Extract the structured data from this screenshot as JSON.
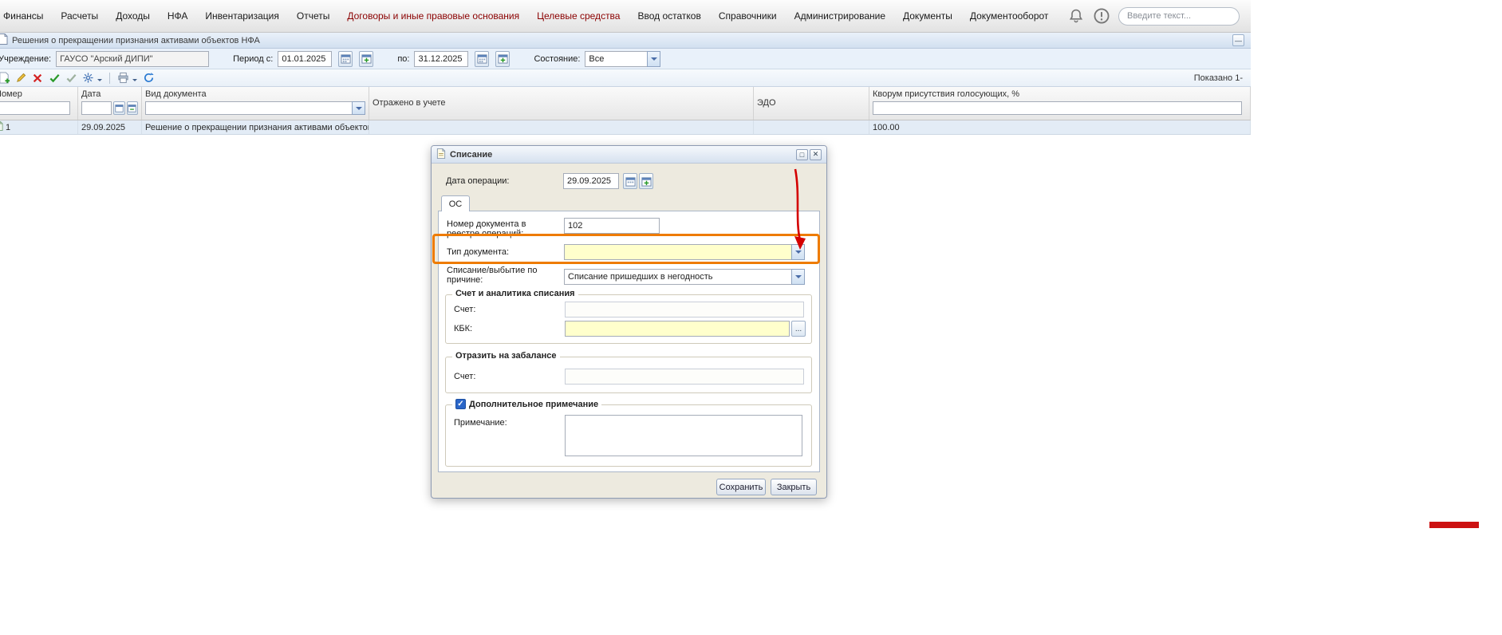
{
  "colors": {
    "menu_accent": "#8b0000",
    "annotation_orange": "#ee7b00",
    "annotation_red": "#d40000",
    "required_field_bg": "#ffffcc"
  },
  "menubar": {
    "items": [
      {
        "label": "Финансы"
      },
      {
        "label": "Расчеты"
      },
      {
        "label": "Доходы"
      },
      {
        "label": "НФА"
      },
      {
        "label": "Инвентаризация"
      },
      {
        "label": "Отчеты"
      },
      {
        "label": "Договоры и иные правовые основания"
      },
      {
        "label": "Целевые средства"
      },
      {
        "label": "Ввод остатков"
      },
      {
        "label": "Справочники"
      },
      {
        "label": "Администрирование"
      },
      {
        "label": "Документы"
      },
      {
        "label": "Документооборот"
      }
    ],
    "search_placeholder": "Введите текст..."
  },
  "panel": {
    "title": "Решения о прекращении признания активами объектов НФА",
    "collapse_glyph": "—",
    "filters": {
      "institution_label": "Учреждение:",
      "institution_value": "ГАУСО \"Арский ДИПИ\"",
      "period_from_label": "Период с:",
      "period_from_value": "01.01.2025",
      "period_to_label": "по:",
      "period_to_value": "31.12.2025",
      "state_label": "Состояние:",
      "state_value": "Все"
    },
    "toolbar": {
      "icons": [
        "add-icon",
        "edit-icon",
        "delete-icon",
        "approve-icon",
        "confirm-icon",
        "actions-icon",
        "print-icon",
        "refresh-icon"
      ],
      "shown_text": "Показано 1-"
    },
    "grid": {
      "columns": [
        "Номер",
        "Дата",
        "Вид документа",
        "Отражено в учете",
        "ЭДО",
        "Кворум присутствия голосующих, %"
      ],
      "rows": [
        {
          "number": "1",
          "date": "29.09.2025",
          "doc_kind": "Решение о прекращении признания активами объектов НФА",
          "reflected": "",
          "edo": "",
          "quorum": "100.00"
        }
      ]
    }
  },
  "dialog": {
    "title": "Списание",
    "maximize_glyph": "□",
    "close_glyph": "✕",
    "operation_date_label": "Дата операции:",
    "operation_date_value": "29.09.2025",
    "tab_label": "ОС",
    "fields": {
      "reg_number_label": "Номер документа в реестре операций:",
      "reg_number_value": "102",
      "doc_type_label": "Тип документа:",
      "doc_type_value": "",
      "writeoff_reason_label": "Списание/выбытие по причине:",
      "writeoff_reason_value": "Списание пришедших в негодность"
    },
    "groups": {
      "account_analytics_legend": "Счет и аналитика списания",
      "account_label": "Счет:",
      "kbk_label": "КБК:",
      "offbalance_legend": "Отразить на забалансе",
      "offbalance_account_label": "Счет:",
      "note_legend": "Дополнительное примечание",
      "note_label": "Примечание:"
    },
    "buttons": {
      "save": "Сохранить",
      "close": "Закрыть"
    }
  }
}
